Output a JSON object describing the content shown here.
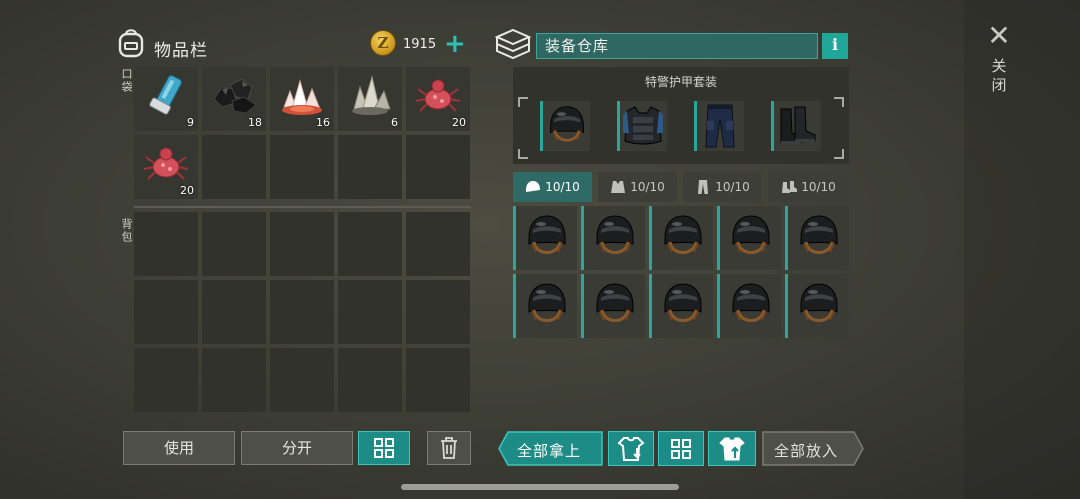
{
  "inventory": {
    "title": "物品栏",
    "coin_symbol": "Z",
    "currency": "1915",
    "pocket_label": "口袋",
    "backpack_label": "背包",
    "pocket_items": [
      {
        "name": "inhaler",
        "count": "9"
      },
      {
        "name": "coal",
        "count": "18"
      },
      {
        "name": "red-crystal",
        "count": "16"
      },
      {
        "name": "quartz-crystal",
        "count": "6"
      },
      {
        "name": "red-tick",
        "count": "20"
      },
      {
        "name": "red-tick",
        "count": "20"
      }
    ]
  },
  "bottom_left": {
    "use_label": "使用",
    "split_label": "分开"
  },
  "warehouse": {
    "title": "装备仓库",
    "info_symbol": "i",
    "suit_name": "特警护甲套装",
    "tabs": [
      {
        "icon": "helmet-icon",
        "count": "10/10"
      },
      {
        "icon": "vest-icon",
        "count": "10/10"
      },
      {
        "icon": "pants-icon",
        "count": "10/10"
      },
      {
        "icon": "boots-icon",
        "count": "10/10"
      }
    ],
    "take_all_label": "全部拿上",
    "put_all_label": "全部放入"
  },
  "close": {
    "symbol": "✕",
    "label": "关闭"
  },
  "colors": {
    "accent": "#2aa79b",
    "teal_button": "#1d8c86",
    "background": "#3e3f36"
  }
}
